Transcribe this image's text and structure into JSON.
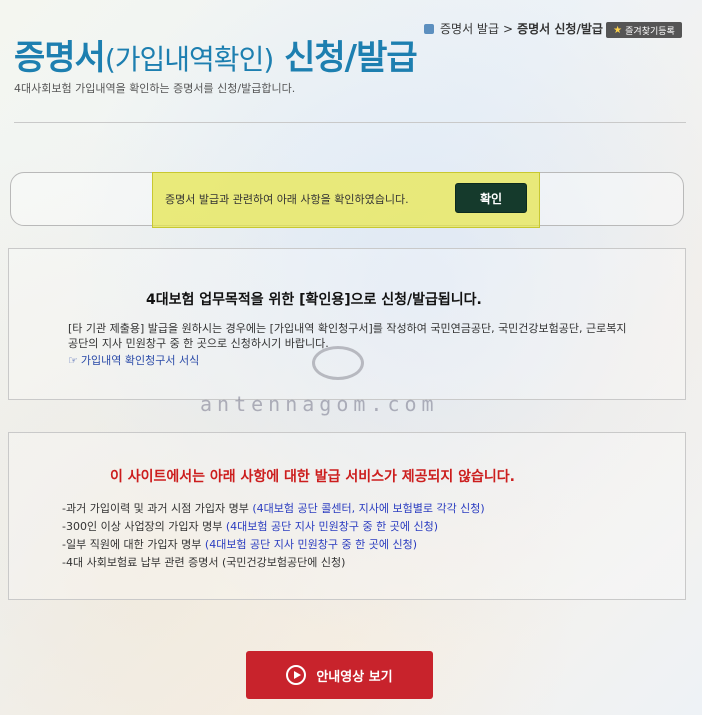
{
  "page": {
    "title_main": "증명서",
    "title_paren": "(가입내역확인)",
    "title_rest": " 신청/발급",
    "subtitle": "4대사회보험 가입내역을 확인하는 증명서를 신청/발급합니다."
  },
  "breadcrumb": {
    "items": [
      "증명서 발급",
      ">",
      "증명서 신청/발급"
    ]
  },
  "favorite_button": {
    "label": "즐겨찾기등록"
  },
  "confirm": {
    "text": "증명서 발급과 관련하여 아래 사항을 확인하였습니다.",
    "button_label": "확인"
  },
  "section1": {
    "heading": "4대보험 업무목적을 위한 [확인용]으로 신청/발급됩니다.",
    "body": "[타 기관 제출용] 발급을 원하시는 경우에는 [가입내역 확인청구서]를 작성하여 국민연금공단, 국민건강보험공단, 근로복지공단의 지사 민원창구 중 한 곳으로 신청하시기 바랍니다.",
    "link": "가입내역 확인청구서 서식"
  },
  "watermark": "antennagom.com",
  "section2": {
    "heading": "이 사이트에서는 아래 사항에 대한 발급 서비스가 제공되지 않습니다.",
    "items": [
      {
        "text": "-과거 가입이력 및 과거 시점 가입자 명부 ",
        "note": "(4대보험 공단 콜센터, 지사에 보험별로 각각 신청)"
      },
      {
        "text": "-300인 이상 사업장의 가입자 명부 ",
        "note": "(4대보험 공단 지사 민원창구 중 한 곳에 신청)"
      },
      {
        "text": "-일부 직원에 대한 가입자 명부 ",
        "note": "(4대보험 공단 지사 민원창구 중 한 곳에 신청)"
      },
      {
        "text": "-4대 사회보험료 납부 관련 증명서 (국민건강보험공단에 신청)",
        "note": ""
      }
    ]
  },
  "video_button": {
    "label": "안내영상 보기"
  },
  "colors": {
    "title_blue": "#1d7fb0",
    "highlight": "#e6e650",
    "confirm_button": "#153a2c",
    "alert_red": "#cc1d1d",
    "video_button": "#c8232c"
  }
}
